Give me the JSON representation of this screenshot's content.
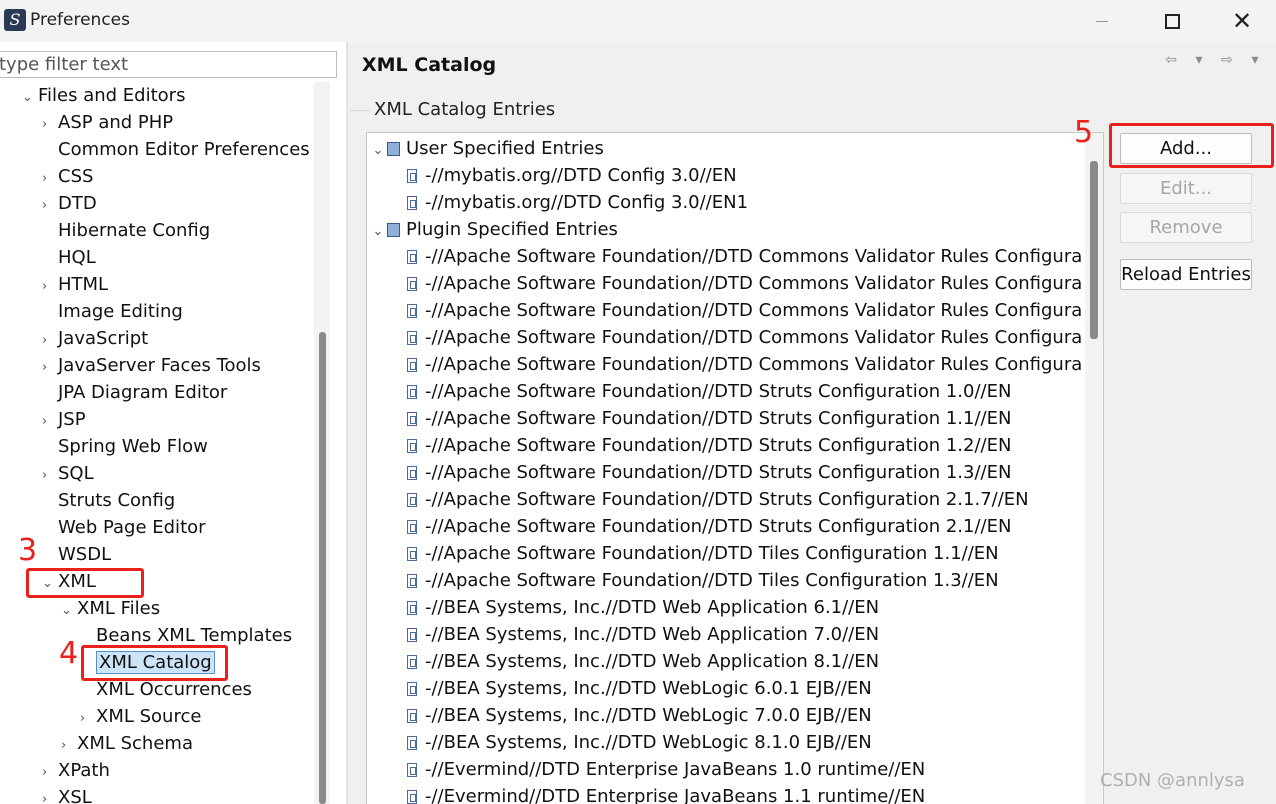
{
  "window": {
    "title": "Preferences"
  },
  "filter": {
    "placeholder": "type filter text"
  },
  "tree": [
    {
      "label": "Files and Editors",
      "level": 0,
      "expander": "expanded"
    },
    {
      "label": "ASP and PHP",
      "level": 1,
      "expander": "collapsed"
    },
    {
      "label": "Common Editor Preferences",
      "level": 1,
      "expander": "none"
    },
    {
      "label": "CSS",
      "level": 1,
      "expander": "collapsed"
    },
    {
      "label": "DTD",
      "level": 1,
      "expander": "collapsed"
    },
    {
      "label": "Hibernate Config",
      "level": 1,
      "expander": "none"
    },
    {
      "label": "HQL",
      "level": 1,
      "expander": "none"
    },
    {
      "label": "HTML",
      "level": 1,
      "expander": "collapsed"
    },
    {
      "label": "Image Editing",
      "level": 1,
      "expander": "none"
    },
    {
      "label": "JavaScript",
      "level": 1,
      "expander": "collapsed"
    },
    {
      "label": "JavaServer Faces Tools",
      "level": 1,
      "expander": "collapsed"
    },
    {
      "label": "JPA Diagram Editor",
      "level": 1,
      "expander": "none"
    },
    {
      "label": "JSP",
      "level": 1,
      "expander": "collapsed"
    },
    {
      "label": "Spring Web Flow",
      "level": 1,
      "expander": "none"
    },
    {
      "label": "SQL",
      "level": 1,
      "expander": "collapsed"
    },
    {
      "label": "Struts Config",
      "level": 1,
      "expander": "none"
    },
    {
      "label": "Web Page Editor",
      "level": 1,
      "expander": "none"
    },
    {
      "label": "WSDL",
      "level": 1,
      "expander": "none"
    },
    {
      "label": "XML",
      "level": 1,
      "expander": "expanded"
    },
    {
      "label": "XML Files",
      "level": 2,
      "expander": "expanded"
    },
    {
      "label": "Beans XML Templates",
      "level": 3,
      "expander": "none"
    },
    {
      "label": "XML Catalog",
      "level": 3,
      "expander": "none",
      "selected": true
    },
    {
      "label": "XML Occurrences",
      "level": 3,
      "expander": "none"
    },
    {
      "label": "XML Source",
      "level": 3,
      "expander": "collapsed"
    },
    {
      "label": "XML Schema",
      "level": 2,
      "expander": "collapsed"
    },
    {
      "label": "XPath",
      "level": 1,
      "expander": "collapsed"
    },
    {
      "label": "XSL",
      "level": 1,
      "expander": "collapsed"
    }
  ],
  "page": {
    "title": "XML Catalog",
    "group_title": "XML Catalog Entries"
  },
  "entries": [
    {
      "label": "User Specified Entries",
      "kind": "category"
    },
    {
      "label": "-//mybatis.org//DTD Config 3.0//EN",
      "kind": "entry"
    },
    {
      "label": "-//mybatis.org//DTD Config 3.0//EN1",
      "kind": "entry"
    },
    {
      "label": "Plugin Specified Entries",
      "kind": "category"
    },
    {
      "label": "-//Apache Software Foundation//DTD Commons Validator Rules Configura",
      "kind": "entry"
    },
    {
      "label": "-//Apache Software Foundation//DTD Commons Validator Rules Configura",
      "kind": "entry"
    },
    {
      "label": "-//Apache Software Foundation//DTD Commons Validator Rules Configura",
      "kind": "entry"
    },
    {
      "label": "-//Apache Software Foundation//DTD Commons Validator Rules Configura",
      "kind": "entry"
    },
    {
      "label": "-//Apache Software Foundation//DTD Commons Validator Rules Configura",
      "kind": "entry"
    },
    {
      "label": "-//Apache Software Foundation//DTD Struts Configuration 1.0//EN",
      "kind": "entry"
    },
    {
      "label": "-//Apache Software Foundation//DTD Struts Configuration 1.1//EN",
      "kind": "entry"
    },
    {
      "label": "-//Apache Software Foundation//DTD Struts Configuration 1.2//EN",
      "kind": "entry"
    },
    {
      "label": "-//Apache Software Foundation//DTD Struts Configuration 1.3//EN",
      "kind": "entry"
    },
    {
      "label": "-//Apache Software Foundation//DTD Struts Configuration 2.1.7//EN",
      "kind": "entry"
    },
    {
      "label": "-//Apache Software Foundation//DTD Struts Configuration 2.1//EN",
      "kind": "entry"
    },
    {
      "label": "-//Apache Software Foundation//DTD Tiles Configuration 1.1//EN",
      "kind": "entry"
    },
    {
      "label": "-//Apache Software Foundation//DTD Tiles Configuration 1.3//EN",
      "kind": "entry"
    },
    {
      "label": "-//BEA Systems, Inc.//DTD Web Application 6.1//EN",
      "kind": "entry"
    },
    {
      "label": "-//BEA Systems, Inc.//DTD Web Application 7.0//EN",
      "kind": "entry"
    },
    {
      "label": "-//BEA Systems, Inc.//DTD Web Application 8.1//EN",
      "kind": "entry"
    },
    {
      "label": "-//BEA Systems, Inc.//DTD WebLogic 6.0.1 EJB//EN",
      "kind": "entry"
    },
    {
      "label": "-//BEA Systems, Inc.//DTD WebLogic 7.0.0 EJB//EN",
      "kind": "entry"
    },
    {
      "label": "-//BEA Systems, Inc.//DTD WebLogic 8.1.0 EJB//EN",
      "kind": "entry"
    },
    {
      "label": "-//Evermind//DTD Enterprise JavaBeans 1.0 runtime//EN",
      "kind": "entry"
    },
    {
      "label": "-//Evermind//DTD Enterprise JavaBeans 1.1 runtime//EN",
      "kind": "entry"
    }
  ],
  "buttons": {
    "add": "Add...",
    "edit": "Edit...",
    "remove": "Remove",
    "reload": "Reload Entries"
  },
  "annotations": {
    "n3": "3",
    "n4": "4",
    "n5": "5"
  },
  "watermark": "CSDN @annlysa",
  "colors": {
    "annotation": "#e8211b",
    "selection": "#cce4f7"
  }
}
